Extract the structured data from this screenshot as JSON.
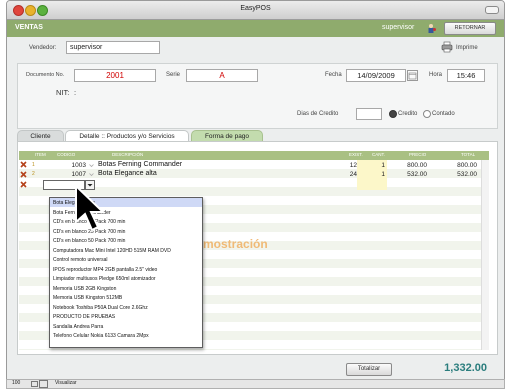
{
  "window": {
    "title": "EasyPOS"
  },
  "header": {
    "section": "VENTAS",
    "user": "supervisor",
    "back_label": "RETORNAR"
  },
  "form": {
    "vendor_label": "Vendedor:",
    "vendor_value": "supervisor",
    "print_label": "Imprime",
    "doc_label": "Documento No.",
    "doc_value": "2001",
    "serie_label": "Serie",
    "serie_value": "A",
    "fecha_label": "Fecha",
    "fecha_value": "14/09/2009",
    "hora_label": "Hora",
    "hora_value": "15:46",
    "nit_label": "NIT:",
    "nit_value": ":",
    "dias_label": "Dias de Credito",
    "credito_label": "Credito",
    "contado_label": "Contado"
  },
  "tabs": [
    "Cliente",
    "Detalle :: Productos y/o Servicios",
    "Forma de pago"
  ],
  "grid": {
    "columns": [
      "ITEM",
      "CODIGO",
      "DESCRIPCIÓN",
      "EXIST.",
      "CANT.",
      "PRECIO",
      "TOTAL"
    ],
    "rows": [
      {
        "item": "1",
        "code": "1003",
        "desc": "Botas Ferning Commander",
        "exist": "12",
        "qty": "1",
        "price": "800.00",
        "total": "800.00"
      },
      {
        "item": "2",
        "code": "1007",
        "desc": "Bota Elegance alta",
        "exist": "24",
        "qty": "1",
        "price": "532.00",
        "total": "532.00"
      }
    ]
  },
  "watermark": "mostración",
  "dropdown": {
    "items": [
      "Bota Elegance alta",
      "Bota Ferning Commander",
      "CD's en blanco 10 Pack 700 min",
      "CD's en blanco 25 Pack 700 min",
      "CD's en blanco 50 Pack 700 min",
      "Computadora Mac Mini Intel 120HD 515M RAM DVD",
      "Control remoto universal",
      "IPOS reproductor MP4 2GB pantalla 2.5\" video",
      "Limpiador multiusos Pledge 650ml atomizador",
      "Memoria USB 2GB Kingston",
      "Memoria USB Kingston 512MB",
      "Notebook Toshiba P50A Dual Core 2.6Ghz",
      "PRODUCTO DE PRUEBAS",
      "Sandalia Andrea Parra",
      "Telefono Celular Nokia 6133 Camara 2Mpx"
    ]
  },
  "totals": {
    "label": "Totalizar",
    "amount": "1,332.00"
  },
  "statusbar": {
    "zoom": "100",
    "mode": "Visualizar"
  }
}
